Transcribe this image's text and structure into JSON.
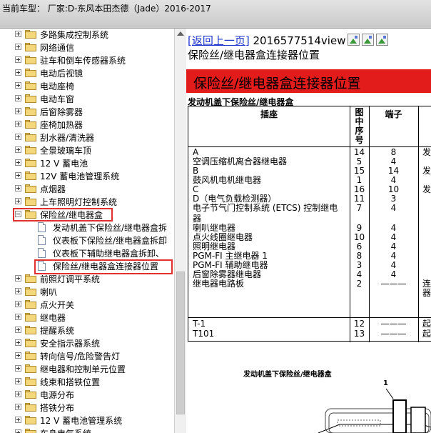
{
  "window": {
    "title": "当前车型：  厂家:D-东风本田杰德（Jade）2016-2017"
  },
  "tree": {
    "items": [
      {
        "label": "多路集成控制系统",
        "expander": "plus"
      },
      {
        "label": "网络通信",
        "expander": "plus"
      },
      {
        "label": "驻车和倒车传感器系统",
        "expander": "plus"
      },
      {
        "label": "电动后视镜",
        "expander": "plus"
      },
      {
        "label": "电动座椅",
        "expander": "plus"
      },
      {
        "label": "电动车窗",
        "expander": "plus"
      },
      {
        "label": "后窗除雾器",
        "expander": "plus"
      },
      {
        "label": "座椅加热器",
        "expander": "plus"
      },
      {
        "label": "刮水器/清洗器",
        "expander": "plus"
      },
      {
        "label": "全景玻璃车顶",
        "expander": "plus"
      },
      {
        "label": "12 V 蓄电池",
        "expander": "plus"
      },
      {
        "label": "12V 蓄电池管理系统",
        "expander": "plus"
      },
      {
        "label": "点烟器",
        "expander": "plus"
      },
      {
        "label": "上车照明灯控制系统",
        "expander": "plus"
      },
      {
        "label": "保险丝/继电器盒",
        "expander": "minus"
      }
    ],
    "children": [
      {
        "label": "发动机盖下保险丝/继电器盒拆"
      },
      {
        "label": "仪表板下保险丝/继电器盒拆卸"
      },
      {
        "label": "仪表板下辅助继电器盒拆卸、"
      },
      {
        "label": "保险丝/继电器盒连接器位置"
      }
    ],
    "items_after": [
      {
        "label": "前照灯调平系统",
        "expander": "plus"
      },
      {
        "label": "喇叭",
        "expander": "plus"
      },
      {
        "label": "点火开关",
        "expander": "plus"
      },
      {
        "label": "继电器",
        "expander": "plus"
      },
      {
        "label": "提醒系统",
        "expander": "plus"
      },
      {
        "label": "安全指示器系统",
        "expander": "plus"
      },
      {
        "label": "转向信号/危险警告灯",
        "expander": "plus"
      },
      {
        "label": "继电器和控制单元位置",
        "expander": "plus"
      },
      {
        "label": "线束和搭铁位置",
        "expander": "plus"
      },
      {
        "label": "电源分布",
        "expander": "plus"
      },
      {
        "label": "搭铁分布",
        "expander": "plus"
      },
      {
        "label": "12 V 蓄电池管理系统",
        "expander": "plus"
      },
      {
        "label": "车身电气系统",
        "expander": "plus"
      }
    ]
  },
  "content": {
    "back_link": "[返回上一页]",
    "doc_id": " 2016577514view",
    "subtitle": "保险丝/继电器盒连接器位置",
    "banner": "保险丝/继电器盒连接器位置",
    "section_title": "发动机盖下保险丝/继电器盒",
    "table": {
      "headers": {
        "socket": "插座",
        "fig_no": "图\n中\n序\n号",
        "terminal": "端子"
      },
      "rows": [
        {
          "socket": "A",
          "fig": "14",
          "term": "8",
          "extra": "发"
        },
        {
          "socket": "空调压缩机离合器继电器",
          "fig": "5",
          "term": "4",
          "extra": ""
        },
        {
          "socket": "B",
          "fig": "15",
          "term": "14",
          "extra": "发"
        },
        {
          "socket": "鼓风机电机继电器",
          "fig": "1",
          "term": "4",
          "extra": ""
        },
        {
          "socket": "C",
          "fig": "16",
          "term": "10",
          "extra": "发"
        },
        {
          "socket": "D（电气负载检测器）",
          "fig": "11",
          "term": "3",
          "extra": ""
        },
        {
          "socket": "电子节气门控制系统 (ETCS) 控制继电",
          "fig": "7",
          "term": "4",
          "extra": ""
        },
        {
          "socket": "器",
          "fig": "",
          "term": "",
          "extra": ""
        },
        {
          "socket": "喇叭继电器",
          "fig": "9",
          "term": "4",
          "extra": ""
        },
        {
          "socket": "点火线圈继电器",
          "fig": "10",
          "term": "4",
          "extra": ""
        },
        {
          "socket": "照明继电器",
          "fig": "6",
          "term": "4",
          "extra": ""
        },
        {
          "socket": "PGM-FI 主继电器 1",
          "fig": "8",
          "term": "4",
          "extra": ""
        },
        {
          "socket": "PGM-FI 辅助继电器",
          "fig": "3",
          "term": "4",
          "extra": ""
        },
        {
          "socket": "后窗除雾器继电器",
          "fig": "4",
          "term": "4",
          "extra": ""
        },
        {
          "socket": "继电器电路板",
          "fig": "2",
          "term": "———",
          "extra": "连"
        },
        {
          "socket": "",
          "fig": "",
          "term": "",
          "extra": "器"
        }
      ],
      "rows2": [
        {
          "socket": "T-1",
          "fig": "12",
          "term": "———",
          "extra": "起"
        },
        {
          "socket": "T101",
          "fig": "13",
          "term": "———",
          "extra": "起"
        }
      ]
    },
    "diagram": {
      "title": "发动机盖下保险丝/继电器盒",
      "callout": "1"
    }
  }
}
